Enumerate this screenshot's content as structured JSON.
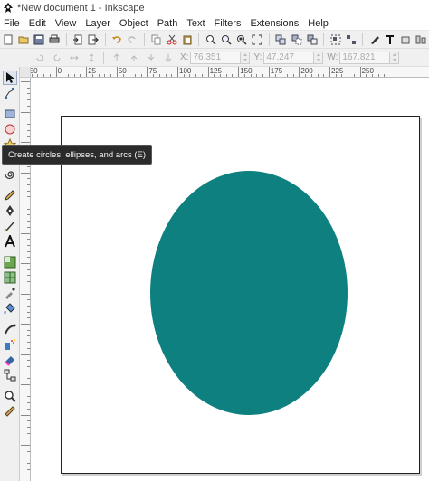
{
  "window": {
    "title": "*New document 1 - Inkscape"
  },
  "menubar": {
    "items": [
      "File",
      "Edit",
      "View",
      "Layer",
      "Object",
      "Path",
      "Text",
      "Filters",
      "Extensions",
      "Help"
    ]
  },
  "commands_bar": {
    "icons": [
      "new-document-icon",
      "open-icon",
      "save-icon",
      "print-icon",
      "import-icon",
      "export-icon",
      "undo-icon",
      "redo-icon",
      "copy-icon",
      "cut-icon",
      "paste-icon",
      "zoom-selection-icon",
      "zoom-drawing-icon",
      "zoom-page-icon",
      "zoom-fit-icon",
      "duplicate-icon",
      "clone-icon",
      "unlink-clone-icon",
      "group-icon",
      "ungroup-icon",
      "fill-stroke-icon",
      "text-font-icon",
      "layers-icon",
      "align-icon"
    ]
  },
  "tool_controls": {
    "x_label": "X:",
    "x_value": "76.351",
    "y_label": "Y:",
    "y_value": "47.247",
    "w_label": "W:",
    "w_value": "167.821"
  },
  "toolbox": {
    "tools": [
      "selector-tool-icon",
      "node-tool-icon",
      "rectangle-tool-icon",
      "ellipse-tool-icon",
      "star-tool-icon",
      "spiral-tool-icon",
      "pencil-tool-icon",
      "pen-tool-icon",
      "calligraphy-tool-icon",
      "text-tool-icon",
      "gradient-tool-icon",
      "mesh-tool-icon",
      "dropper-tool-icon",
      "paint-bucket-tool-icon",
      "tweak-tool-icon",
      "spray-tool-icon",
      "eraser-tool-icon",
      "connector-tool-icon",
      "zoom-tool-icon",
      "measure-tool-icon"
    ]
  },
  "ruler": {
    "h_labels": [
      "-50",
      "0",
      "25",
      "50",
      "75",
      "100",
      "125",
      "150",
      "175",
      "200",
      "225",
      "250"
    ]
  },
  "canvas": {
    "ellipse_color": "#0e8080"
  },
  "tooltip": {
    "text": "Create circles, ellipses, and arcs (E)"
  }
}
